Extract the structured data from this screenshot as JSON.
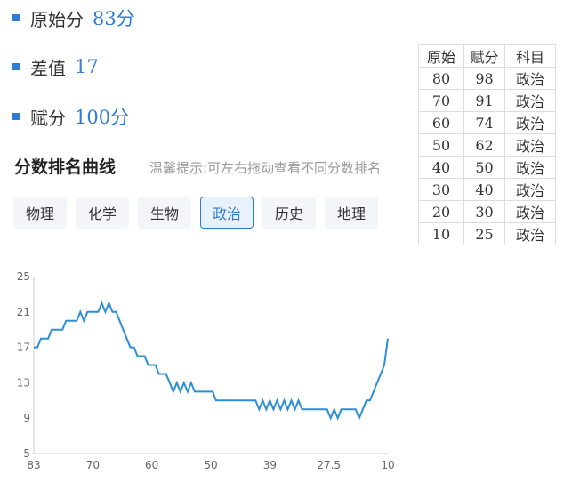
{
  "stats": [
    {
      "label": "原始分",
      "value": "83分"
    },
    {
      "label": "差值",
      "value": "17"
    },
    {
      "label": "赋分",
      "value": "100分"
    }
  ],
  "section": {
    "title": "分数排名曲线",
    "hint": "温馨提示:可左右拖动查看不同分数排名"
  },
  "tabs": [
    {
      "label": "物理",
      "active": false
    },
    {
      "label": "化学",
      "active": false
    },
    {
      "label": "生物",
      "active": false
    },
    {
      "label": "政治",
      "active": true
    },
    {
      "label": "历史",
      "active": false
    },
    {
      "label": "地理",
      "active": false
    }
  ],
  "mapping_table": {
    "headers": [
      "原始",
      "赋分",
      "科目"
    ],
    "rows": [
      [
        "80",
        "98",
        "政治"
      ],
      [
        "70",
        "91",
        "政治"
      ],
      [
        "60",
        "74",
        "政治"
      ],
      [
        "50",
        "62",
        "政治"
      ],
      [
        "40",
        "50",
        "政治"
      ],
      [
        "30",
        "40",
        "政治"
      ],
      [
        "20",
        "30",
        "政治"
      ],
      [
        "10",
        "25",
        "政治"
      ]
    ]
  },
  "colors": {
    "accent": "#2f7bd8",
    "line": "#2c8fd6"
  },
  "chart_data": {
    "type": "line",
    "x_tick_labels": [
      "83",
      "70",
      "60",
      "50",
      "39",
      "27.5",
      "10"
    ],
    "y_ticks": [
      5,
      9,
      13,
      17,
      21,
      25
    ],
    "ylim": [
      5,
      25
    ],
    "x_reversed": true,
    "grid": false,
    "series": [
      {
        "values": [
          17,
          17,
          18,
          18,
          18,
          19,
          19,
          19,
          19,
          20,
          20,
          20,
          20,
          21,
          20,
          21,
          21,
          21,
          21,
          22,
          21,
          22,
          21,
          21,
          20,
          19,
          18,
          17,
          17,
          16,
          16,
          16,
          15,
          15,
          15,
          14,
          14,
          14,
          13,
          12,
          13,
          12,
          13,
          12,
          13,
          12,
          12,
          12,
          12,
          12,
          12,
          11,
          11,
          11,
          11,
          11,
          11,
          11,
          11,
          11,
          11,
          11,
          11,
          10,
          11,
          10,
          11,
          10,
          11,
          10,
          11,
          10,
          11,
          10,
          11,
          10,
          10,
          10,
          10,
          10,
          10,
          10,
          10,
          9,
          10,
          9,
          10,
          10,
          10,
          10,
          10,
          9,
          10,
          11,
          11,
          12,
          13,
          14,
          15,
          18
        ]
      }
    ]
  }
}
